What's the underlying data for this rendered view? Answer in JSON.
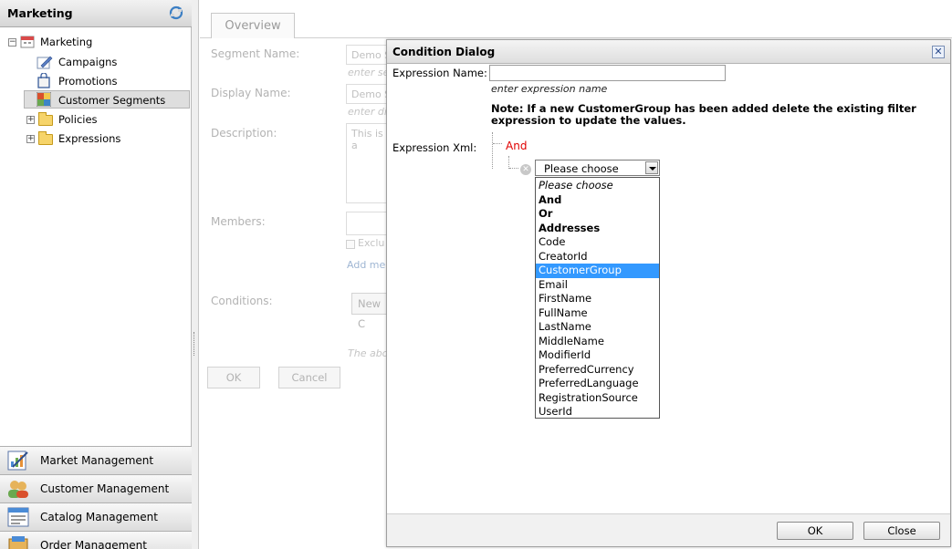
{
  "sidebar": {
    "title": "Marketing",
    "refresh_icon": "refresh-icon",
    "tree": [
      {
        "label": "Marketing",
        "icon": "calendar-icon",
        "expander": "−"
      },
      {
        "label": "Campaigns",
        "icon": "edit-icon"
      },
      {
        "label": "Promotions",
        "icon": "bag-icon"
      },
      {
        "label": "Customer Segments",
        "icon": "grid-icon",
        "selected": true
      },
      {
        "label": "Policies",
        "icon": "folder-icon",
        "expander": "+"
      },
      {
        "label": "Expressions",
        "icon": "folder-icon",
        "expander": "+"
      }
    ],
    "nav": [
      {
        "label": "Market Management",
        "icon": "chart-icon"
      },
      {
        "label": "Customer Management",
        "icon": "people-icon"
      },
      {
        "label": "Catalog Management",
        "icon": "catalog-icon"
      },
      {
        "label": "Order Management",
        "icon": "order-icon"
      }
    ]
  },
  "main": {
    "tab": "Overview",
    "segment_name_label": "Segment Name:",
    "segment_name_value": "Demo S",
    "segment_name_hint": "enter se",
    "display_name_label": "Display Name:",
    "display_name_value": "Demo S",
    "display_name_hint": "enter di",
    "description_label": "Description:",
    "description_value": "This is a",
    "members_label": "Members:",
    "exclude_label": "Exclu",
    "add_member_link": "Add me",
    "conditions_label": "Conditions:",
    "new_condition_button": "New C",
    "footer_hint": "The abo",
    "ok_button": "OK",
    "cancel_button": "Cancel"
  },
  "dialog": {
    "title": "Condition Dialog",
    "close_symbol": "✕",
    "expression_name_label": "Expression Name:",
    "expression_name_value": "",
    "expression_name_hint": "enter expression name",
    "note": "Note: If a new CustomerGroup has been added delete the existing filter expression to update the values.",
    "expression_xml_label": "Expression Xml:",
    "root_operator": "And",
    "remove_symbol": "✕",
    "select_value": "Please choose",
    "options": [
      {
        "label": "Please choose",
        "style": "italic"
      },
      {
        "label": "And",
        "style": "bold"
      },
      {
        "label": "Or",
        "style": "bold"
      },
      {
        "label": "Addresses",
        "style": "bold"
      },
      {
        "label": "Code",
        "style": "normal"
      },
      {
        "label": "CreatorId",
        "style": "normal"
      },
      {
        "label": "CustomerGroup",
        "style": "highlighted"
      },
      {
        "label": "Email",
        "style": "normal"
      },
      {
        "label": "FirstName",
        "style": "normal"
      },
      {
        "label": "FullName",
        "style": "normal"
      },
      {
        "label": "LastName",
        "style": "normal"
      },
      {
        "label": "MiddleName",
        "style": "normal"
      },
      {
        "label": "ModifierId",
        "style": "normal"
      },
      {
        "label": "PreferredCurrency",
        "style": "normal"
      },
      {
        "label": "PreferredLanguage",
        "style": "normal"
      },
      {
        "label": "RegistrationSource",
        "style": "normal"
      },
      {
        "label": "UserId",
        "style": "normal"
      }
    ],
    "ok_button": "OK",
    "close_button": "Close"
  },
  "colors": {
    "highlight": "#3399ff",
    "operator_red": "#e00000"
  }
}
